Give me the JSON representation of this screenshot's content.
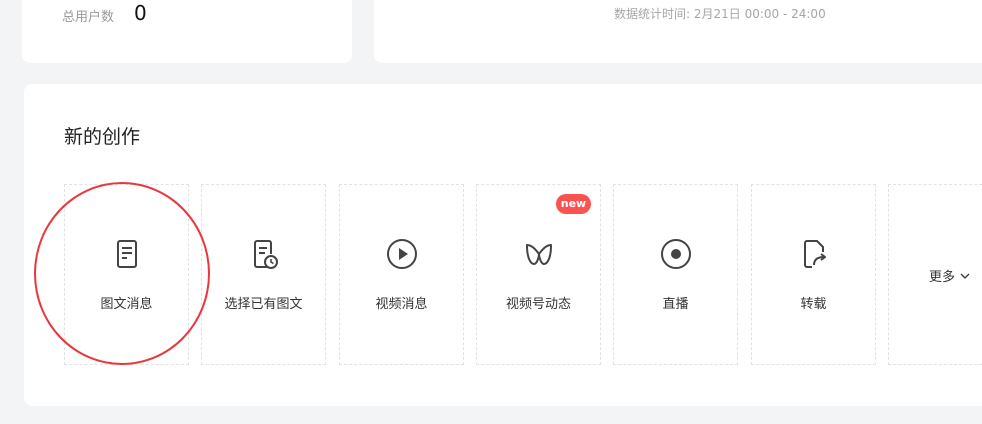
{
  "summary": {
    "total_users_label": "总用户数",
    "total_users_value": "0",
    "stats_time": "数据统计时间: 2月21日 00:00 - 24:00"
  },
  "create": {
    "title": "新的创作",
    "tiles": [
      {
        "label": "图文消息",
        "icon": "document-icon"
      },
      {
        "label": "选择已有图文",
        "icon": "document-clock-icon"
      },
      {
        "label": "视频消息",
        "icon": "play-circle-icon"
      },
      {
        "label": "视频号动态",
        "icon": "butterfly-icon",
        "badge": "new"
      },
      {
        "label": "直播",
        "icon": "record-circle-icon"
      },
      {
        "label": "转载",
        "icon": "repost-icon"
      }
    ],
    "more_label": "更多"
  },
  "colors": {
    "badge": "#fa5151",
    "highlight": "#e8383d",
    "icon": "#444444"
  }
}
